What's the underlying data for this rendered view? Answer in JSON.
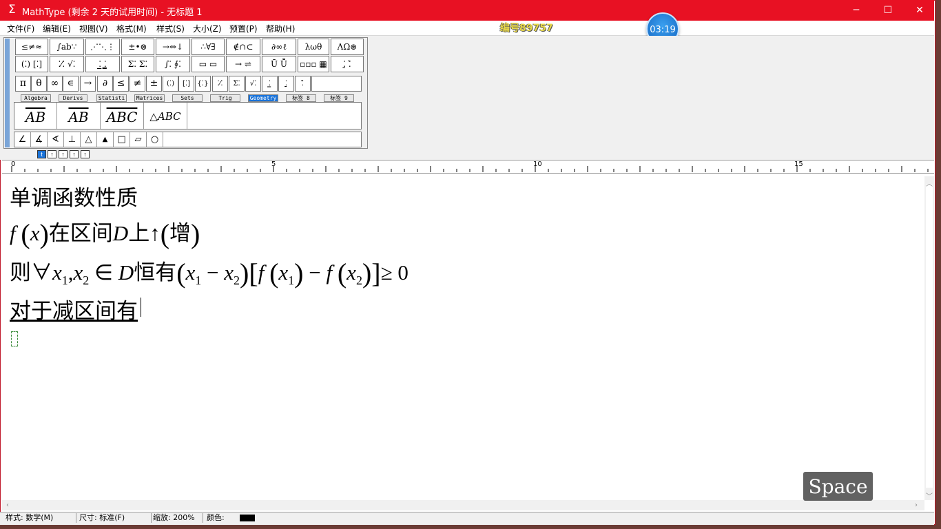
{
  "window": {
    "app_icon": "sigma-icon",
    "title": "MathType (剩余 2 天的试用时间) - 无标题 1",
    "controls": {
      "minimize": "─",
      "maximize": "☐",
      "close": "✕"
    }
  },
  "menu": [
    "文件(F)",
    "编辑(E)",
    "视图(V)",
    "格式(M)",
    "样式(S)",
    "大小(Z)",
    "预置(P)",
    "帮助(H)"
  ],
  "overlay": {
    "id_label": "编号89757",
    "timer": "03:19",
    "key_label": "Space"
  },
  "palette": {
    "row1": [
      "≤≠≈",
      "∫ab∵",
      "⋰⋱⋮",
      "±•⊗",
      "→⇔↓",
      "∴∀∃",
      "∉∩⊂",
      "∂∞ℓ",
      "λωθ",
      "ΛΩ⊛"
    ],
    "row2": [
      "(⁚) [⁚]",
      "⁚⁄⁚ √⁚",
      "⁚̲ ⁚̳",
      "Σ⁚ Σ⁚",
      "∫⁚ ∮⁚",
      "▭ ▭",
      "→ ⇌",
      "Ū Ṻ",
      "▫▫▫ ▦",
      "⁚̱ ⁚̄"
    ],
    "symbols": [
      "π",
      "θ",
      "∞",
      "∊",
      "→",
      "∂",
      "≤",
      "≠",
      "±",
      "(⁚)",
      "[⁚]",
      "{⁚}",
      "⁚⁄⁚",
      "Σ⁚",
      "√⁚",
      "⁚̲",
      "⁚̱",
      "⁚̄"
    ],
    "tabs": [
      "Algebra",
      "Derivs",
      "Statisti",
      "Matrices",
      "Sets",
      "Trig",
      "Geometry",
      "标签 8",
      "标签 9"
    ],
    "active_tab": "Geometry",
    "templates": [
      "AB",
      "AB",
      "ABC",
      "△ABC"
    ],
    "geometry_symbols": [
      "∠",
      "∡",
      "∢",
      "⊥",
      "△",
      "▲",
      "□",
      "▱",
      "○"
    ],
    "levels": [
      "t",
      "↑",
      "↑",
      "↑",
      "↑"
    ]
  },
  "ruler": {
    "marks": [
      "0",
      "5",
      "10",
      "15"
    ]
  },
  "document": {
    "line1": "单调函数性质",
    "line2": {
      "f": "f",
      "x": "x",
      "text1": "在区间",
      "D": "D",
      "text2": "上",
      "arrow": "↑",
      "text3": "增"
    },
    "line3": {
      "prefix": "则",
      "forall": "∀",
      "x1": "x",
      "s1": "1",
      "x2": "x",
      "s2": "2",
      "in": "∈",
      "D": "D",
      "text": "恒有",
      "geq": "≥ 0"
    },
    "line4": "对于减区间有"
  },
  "status": {
    "style": "样式: 数学(M)",
    "size": "尺寸: 标准(F)",
    "zoom": "缩放: 200%",
    "color_label": "颜色:",
    "color_value": "#000000"
  }
}
